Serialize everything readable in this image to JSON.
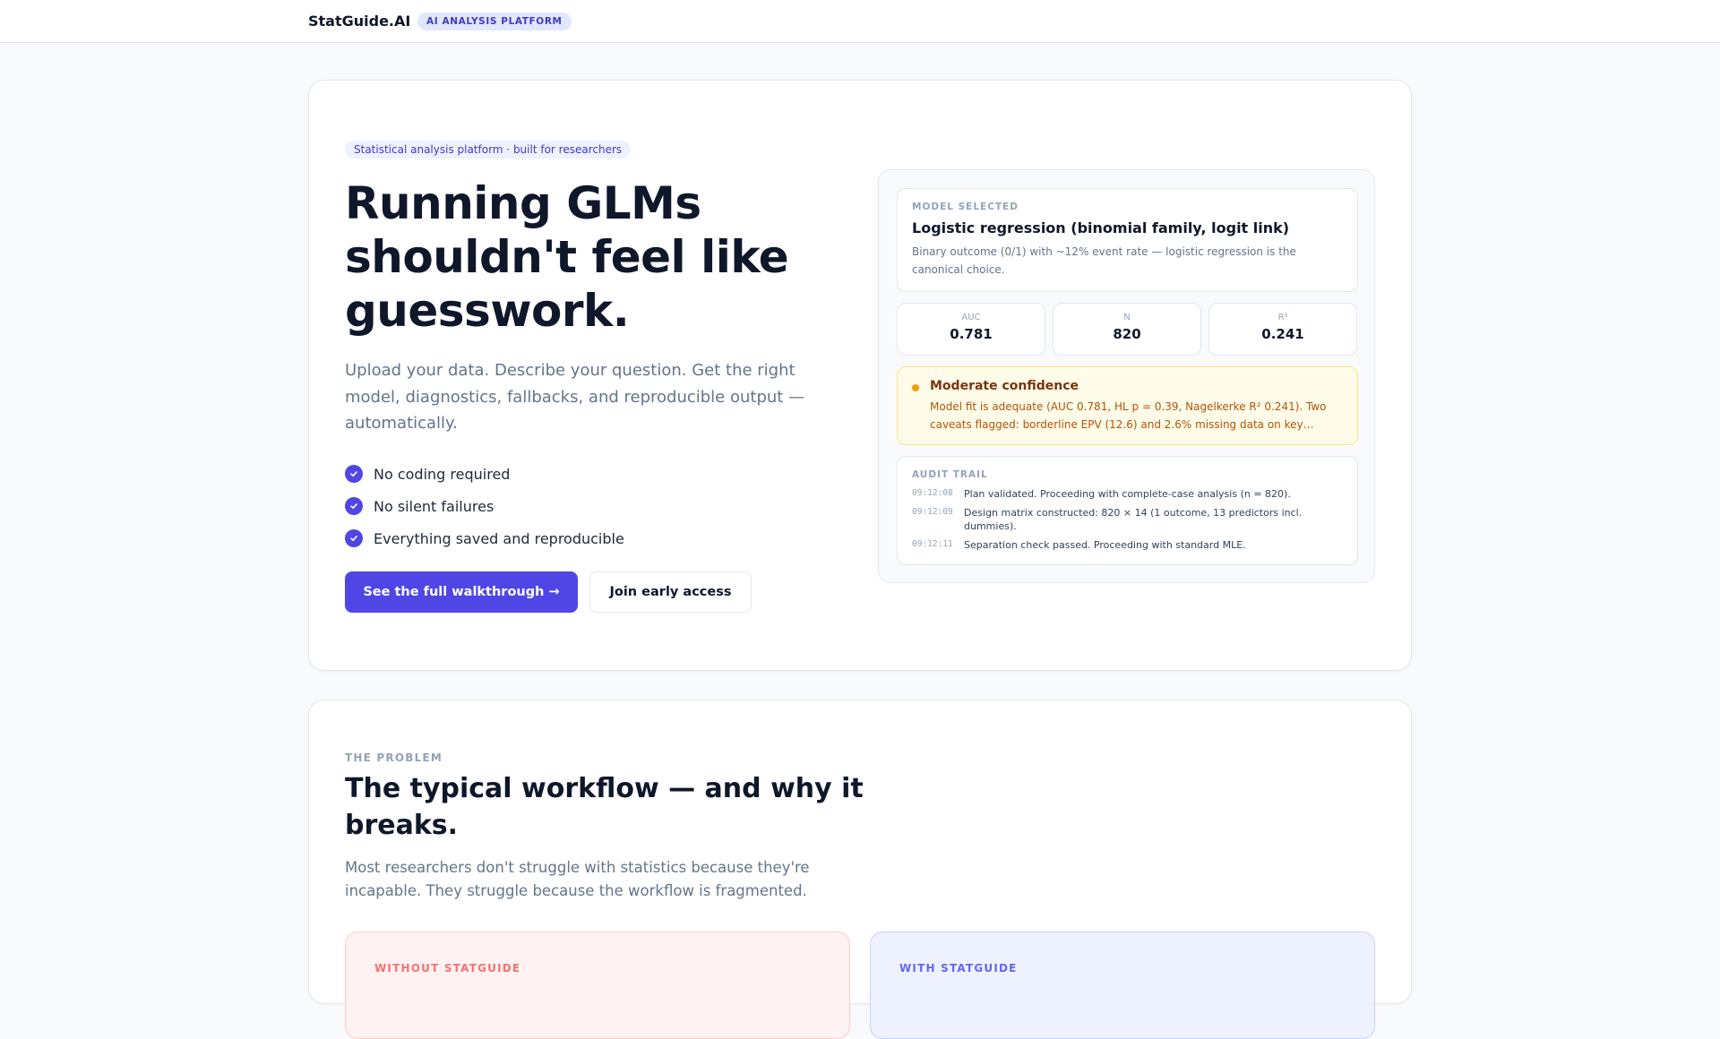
{
  "header": {
    "brand": "StatGuide.AI",
    "badge": "AI ANALYSIS PLATFORM"
  },
  "hero": {
    "tagline": "Statistical analysis platform · built for researchers",
    "headline": "Running GLMs shouldn't feel like guesswork.",
    "subtext": "Upload your data. Describe your question. Get the right model, diagnostics, fallbacks, and reproducible output — automatically.",
    "checklist": [
      "No coding required",
      "No silent failures",
      "Everything saved and reproducible"
    ],
    "primary_cta": "See the full walkthrough →",
    "secondary_cta": "Join early access"
  },
  "panel": {
    "model_label": "MODEL SELECTED",
    "model_title": "Logistic regression (binomial family, logit link)",
    "model_desc": "Binary outcome (0/1) with ~12% event rate — logistic regression is the canonical choice.",
    "metrics": [
      {
        "label": "AUC",
        "value": "0.781"
      },
      {
        "label": "N",
        "value": "820"
      },
      {
        "label": "R²",
        "value": "0.241"
      }
    ],
    "confidence_title": "Moderate confidence",
    "confidence_text": "Model fit is adequate (AUC 0.781, HL p = 0.39, Nagelkerke R² 0.241). Two caveats flagged: borderline EPV (12.6) and 2.6% missing data on key…",
    "audit_label": "AUDIT TRAIL",
    "audit": [
      {
        "time": "09:12:08",
        "msg": "Plan validated. Proceeding with complete-case analysis (n = 820)."
      },
      {
        "time": "09:12:09",
        "msg": "Design matrix constructed: 820 × 14 (1 outcome, 13 predictors incl. dummies)."
      },
      {
        "time": "09:12:11",
        "msg": "Separation check passed. Proceeding with standard MLE."
      }
    ]
  },
  "problem": {
    "eyebrow": "THE PROBLEM",
    "title": "The typical workflow — and why it breaks.",
    "subtext": "Most researchers don't struggle with statistics because they're incapable. They struggle because the workflow is fragmented.",
    "without_label": "WITHOUT STATGUIDE",
    "with_label": "WITH STATGUIDE"
  },
  "colors": {
    "accent": "#4f46e5",
    "warning": "#f59e0b"
  }
}
